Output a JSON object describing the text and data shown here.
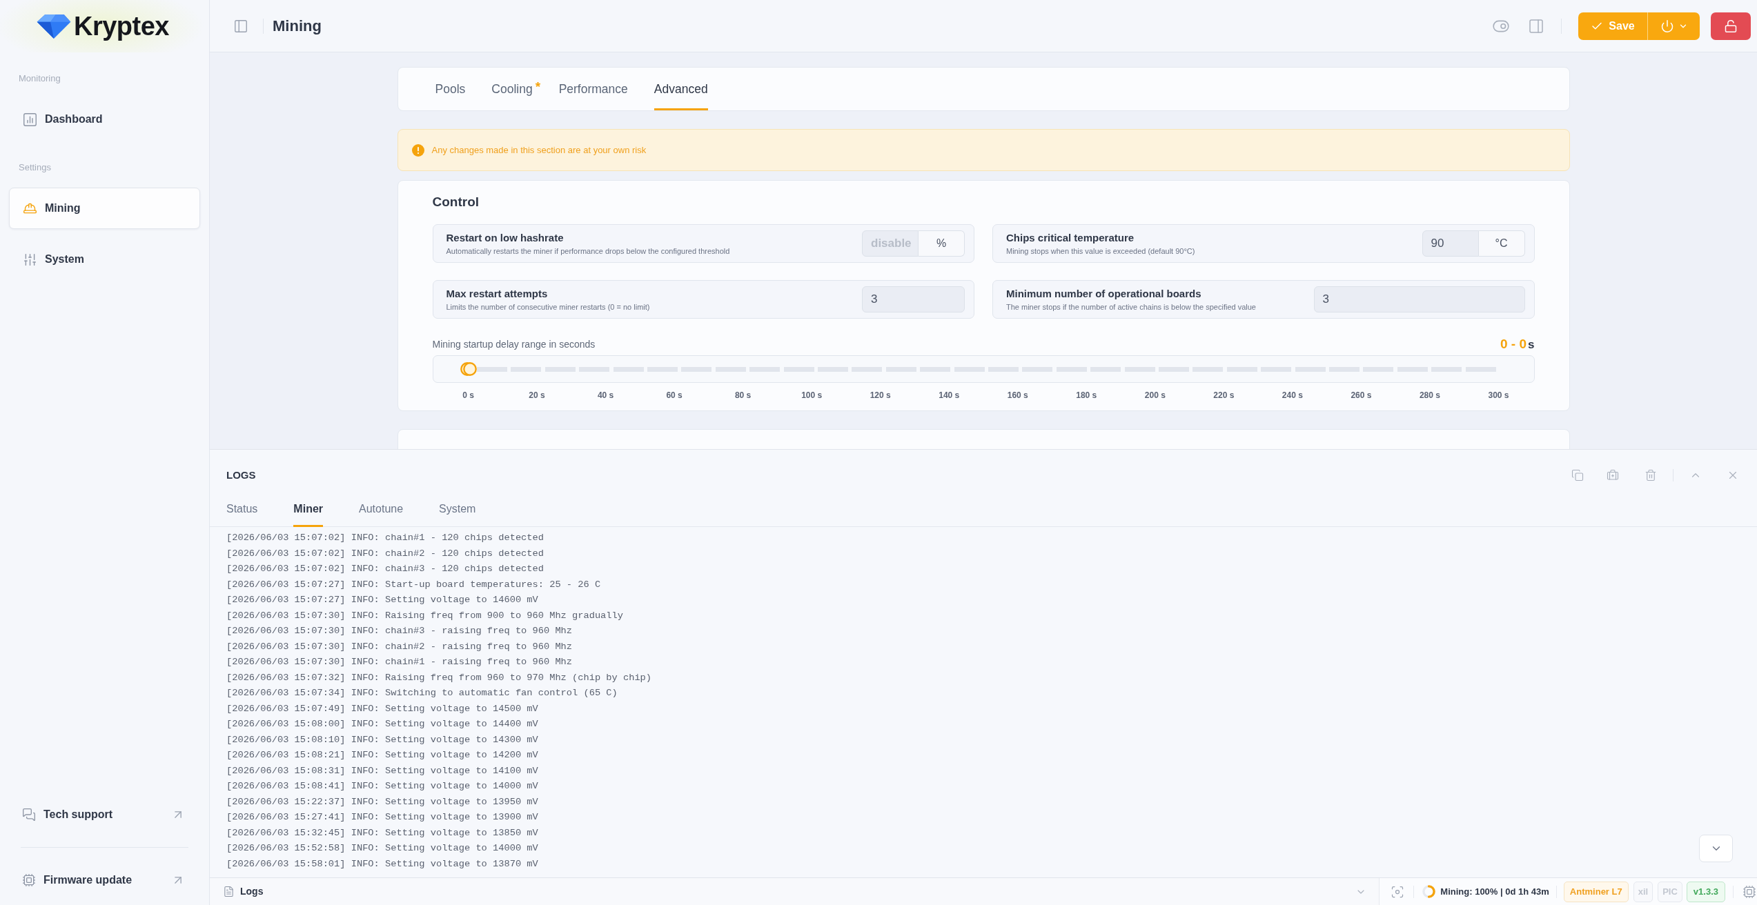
{
  "sidebar": {
    "logo": "Kryptex",
    "groups": [
      {
        "heading": "Monitoring",
        "items": [
          {
            "label": "Dashboard",
            "selected": false
          }
        ]
      },
      {
        "heading": "Settings",
        "items": [
          {
            "label": "Mining",
            "selected": true
          },
          {
            "label": "System",
            "selected": false
          }
        ]
      }
    ],
    "footer_links": [
      "Tech support",
      "Firmware update"
    ]
  },
  "header": {
    "title": "Mining",
    "save_label": "Save"
  },
  "tabs": [
    {
      "label": "Pools",
      "selected": false
    },
    {
      "label": "Cooling",
      "selected": false,
      "marker": "*"
    },
    {
      "label": "Performance",
      "selected": false
    },
    {
      "label": "Advanced",
      "selected": true
    }
  ],
  "warning": "Any changes made in this section are at your own risk",
  "control": {
    "title": "Control",
    "settings": [
      {
        "label": "Restart on low hashrate",
        "description": "Automatically restarts the miner if performance drops below the configured threshold",
        "placeholder": "disable",
        "unit": "%"
      },
      {
        "label": "Chips critical temperature",
        "description": "Mining stops when this value is exceeded (default 90°C)",
        "value": "90",
        "unit": "°C"
      },
      {
        "label": "Max restart attempts",
        "description": "Limits the number of consecutive miner restarts (0 = no limit)",
        "value": "3"
      },
      {
        "label": "Minimum number of operational boards",
        "description": "The miner stops if the number of active chains is below the specified value",
        "value": "3"
      }
    ],
    "startup_delay": {
      "label": "Mining startup delay range in seconds",
      "range_text": "0 - 0",
      "unit": "s",
      "thumbs": [
        {
          "level": 0
        },
        {
          "level": 0
        }
      ],
      "ticks": [
        "0 s",
        "20 s",
        "40 s",
        "60 s",
        "80 s",
        "100 s",
        "120 s",
        "140 s",
        "160 s",
        "180 s",
        "200 s",
        "220 s",
        "240 s",
        "260 s",
        "280 s",
        "300 s"
      ]
    }
  },
  "logs": {
    "title": "LOGS",
    "tabs": [
      {
        "label": "Status",
        "selected": false
      },
      {
        "label": "Miner",
        "selected": true
      },
      {
        "label": "Autotune",
        "selected": false
      },
      {
        "label": "System",
        "selected": false
      }
    ],
    "lines": [
      "[2026/06/03 15:07:02] INFO: chain#1 - 120 chips detected",
      "[2026/06/03 15:07:02] INFO: chain#2 - 120 chips detected",
      "[2026/06/03 15:07:02] INFO: chain#3 - 120 chips detected",
      "[2026/06/03 15:07:27] INFO: Start-up board temperatures: 25 - 26 C",
      "[2026/06/03 15:07:27] INFO: Setting voltage to 14600 mV",
      "[2026/06/03 15:07:30] INFO: Raising freq from 900 to 960 Mhz gradually",
      "[2026/06/03 15:07:30] INFO: chain#3 - raising freq to 960 Mhz",
      "[2026/06/03 15:07:30] INFO: chain#2 - raising freq to 960 Mhz",
      "[2026/06/03 15:07:30] INFO: chain#1 - raising freq to 960 Mhz",
      "[2026/06/03 15:07:32] INFO: Raising freq from 960 to 970 Mhz (chip by chip)",
      "[2026/06/03 15:07:34] INFO: Switching to automatic fan control (65 C)",
      "[2026/06/03 15:07:49] INFO: Setting voltage to 14500 mV",
      "[2026/06/03 15:08:00] INFO: Setting voltage to 14400 mV",
      "[2026/06/03 15:08:10] INFO: Setting voltage to 14300 mV",
      "[2026/06/03 15:08:21] INFO: Setting voltage to 14200 mV",
      "[2026/06/03 15:08:31] INFO: Setting voltage to 14100 mV",
      "[2026/06/03 15:08:41] INFO: Setting voltage to 14000 mV",
      "[2026/06/03 15:22:37] INFO: Setting voltage to 13950 mV",
      "[2026/06/03 15:27:41] INFO: Setting voltage to 13900 mV",
      "[2026/06/03 15:32:45] INFO: Setting voltage to 13850 mV",
      "[2026/06/03 15:52:58] INFO: Setting voltage to 14000 mV",
      "[2026/06/03 15:58:01] INFO: Setting voltage to 13870 mV"
    ]
  },
  "status_bar": {
    "label": "Logs",
    "mining_status": "Mining: 100% | 0d 1h 43m",
    "model": "Antminer L7",
    "tags": [
      "xil",
      "PIC"
    ],
    "version": "v1.3.3"
  }
}
